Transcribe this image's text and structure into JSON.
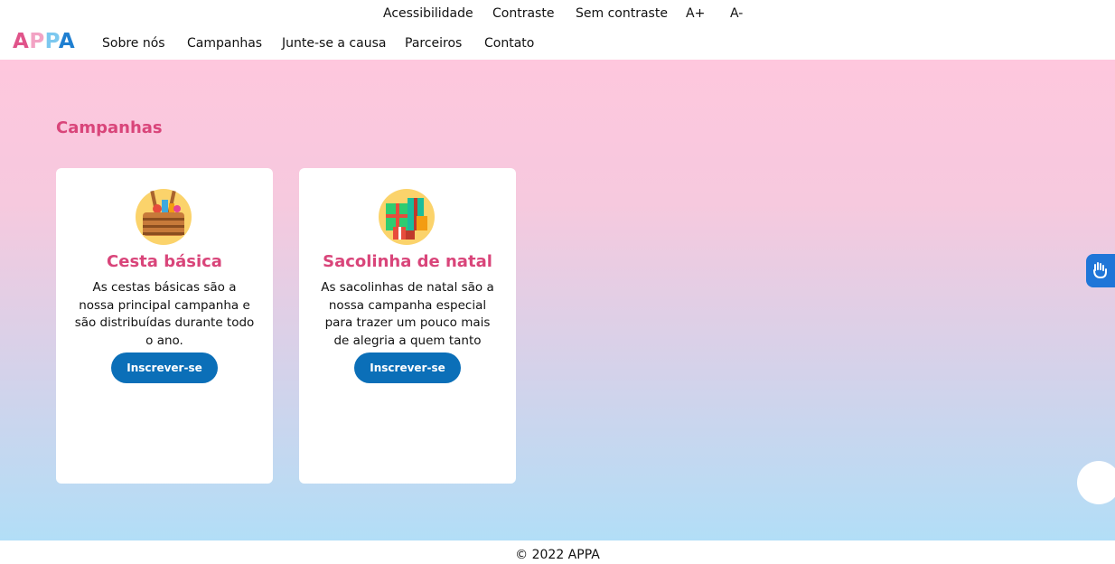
{
  "accessibility_bar": {
    "items": [
      "Acessibilidade",
      "Contraste",
      "Sem contraste",
      "A+",
      "A-"
    ]
  },
  "header": {
    "logo_letters": [
      "A",
      "P",
      "P",
      "A"
    ],
    "nav": [
      "Sobre nós",
      "Campanhas",
      "Junte-se a causa",
      "Parceiros",
      "Contato"
    ]
  },
  "main": {
    "section_title": "Campanhas",
    "cards": [
      {
        "icon": "basket-icon",
        "title": "Cesta básica",
        "description": "As cestas básicas são a nossa principal campanha e são distribuídas durante todo o ano.",
        "button": "Inscrever-se"
      },
      {
        "icon": "gifts-icon",
        "title": "Sacolinha de natal",
        "description": "As sacolinhas de natal são a nossa campanha especial para trazer um pouco mais de alegria a quem tanto precisa.",
        "button": "Inscrever-se"
      }
    ]
  },
  "widgets": {
    "sign_language": "sign-language-icon",
    "round_button": "chat-bubble-icon"
  },
  "footer": {
    "text": "© 2022 APPA"
  },
  "colors": {
    "accent_pink": "#d9457a",
    "button_blue": "#0b6fb8",
    "gradient_top": "#fec7dd",
    "gradient_bottom": "#b2def7"
  }
}
